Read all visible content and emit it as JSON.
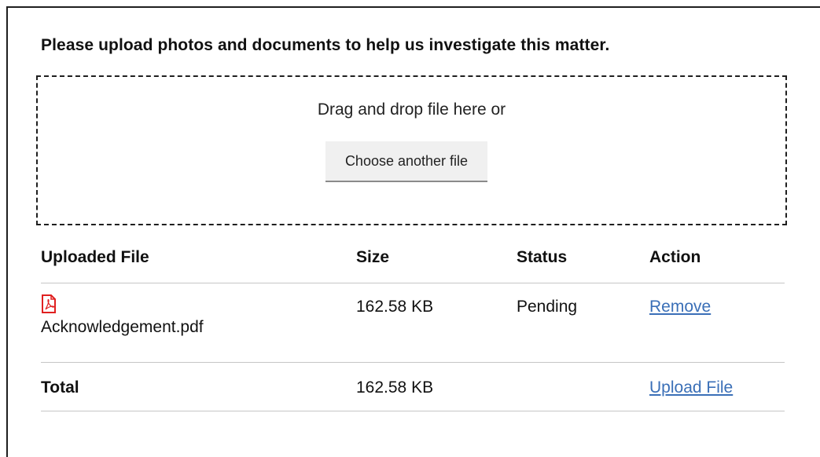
{
  "heading": "Please upload photos and documents to help us investigate this matter.",
  "dropzone": {
    "text": "Drag and drop file here or",
    "button_label": "Choose another file"
  },
  "table": {
    "headers": {
      "file": "Uploaded File",
      "size": "Size",
      "status": "Status",
      "action": "Action"
    },
    "files": [
      {
        "icon": "pdf-file-icon",
        "name": "Acknowledgement.pdf",
        "size": "162.58 KB",
        "status": "Pending",
        "action": "Remove"
      }
    ],
    "total": {
      "label": "Total",
      "size": "162.58 KB",
      "action": "Upload File"
    }
  },
  "colors": {
    "link": "#3a6fb7",
    "pdf_icon": "#e02020",
    "button_bg": "#f0f0f0"
  }
}
